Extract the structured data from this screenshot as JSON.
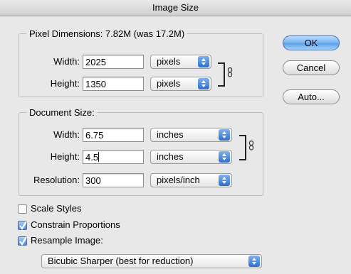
{
  "window": {
    "title": "Image Size"
  },
  "pixel_dimensions": {
    "title": "Pixel Dimensions:  7.82M (was 17.2M)",
    "width_label": "Width:",
    "width_value": "2025",
    "width_unit": "pixels",
    "height_label": "Height:",
    "height_value": "1350",
    "height_unit": "pixels"
  },
  "document_size": {
    "title": "Document Size:",
    "width_label": "Width:",
    "width_value": "6.75",
    "width_unit": "inches",
    "height_label": "Height:",
    "height_value": "4.5",
    "height_unit": "inches",
    "resolution_label": "Resolution:",
    "resolution_value": "300",
    "resolution_unit": "pixels/inch"
  },
  "buttons": {
    "ok": "OK",
    "cancel": "Cancel",
    "auto": "Auto..."
  },
  "options": {
    "scale_styles": {
      "label": "Scale Styles",
      "checked": false
    },
    "constrain_proportions": {
      "label": "Constrain Proportions",
      "checked": true
    },
    "resample_image": {
      "label": "Resample Image:",
      "checked": true
    },
    "resample_method": "Bicubic Sharper (best for reduction)"
  },
  "colors": {
    "accent": "#5fa2ea",
    "check": "#4d8ee0"
  },
  "icons": {
    "link": "chain-link-icon",
    "select_arrows": "updown-arrows-icon",
    "check": "checkmark-icon"
  }
}
